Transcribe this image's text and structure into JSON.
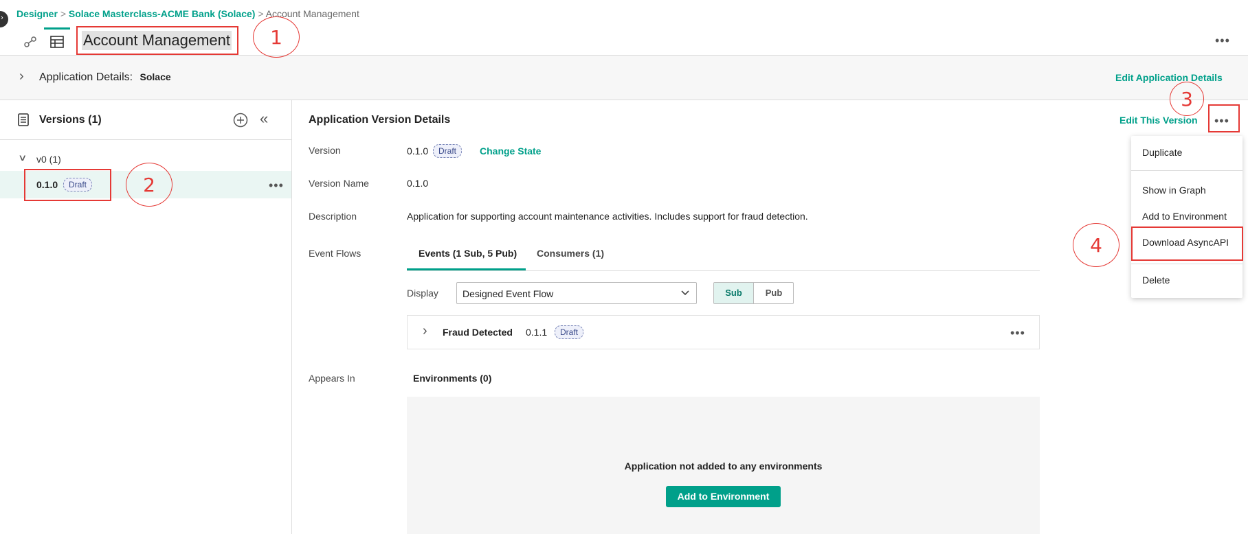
{
  "breadcrumb": {
    "items": [
      "Designer",
      "Solace Masterclass-ACME Bank (Solace)",
      "Account Management"
    ],
    "separator": ">"
  },
  "header": {
    "title": "Account Management"
  },
  "app_details": {
    "label": "Application Details:",
    "value": "Solace",
    "edit_link": "Edit Application Details"
  },
  "versions_panel": {
    "title": "Versions (1)",
    "group": "v0 (1)",
    "items": [
      {
        "version": "0.1.0",
        "state": "Draft"
      }
    ]
  },
  "version_details": {
    "title": "Application Version Details",
    "edit_link": "Edit This Version",
    "version_label": "Version",
    "version_value": "0.1.0",
    "version_state": "Draft",
    "change_state": "Change State",
    "name_label": "Version Name",
    "name_value": "0.1.0",
    "description_label": "Description",
    "description_value": "Application for supporting account maintenance activities. Includes support for fraud detection.",
    "event_flows_label": "Event Flows",
    "tabs": [
      "Events (1 Sub, 5 Pub)",
      "Consumers (1)"
    ],
    "display_label": "Display",
    "display_value": "Designed Event Flow",
    "toggle": [
      "Sub",
      "Pub"
    ],
    "event": {
      "name": "Fraud Detected",
      "version": "0.1.1",
      "state": "Draft"
    },
    "appears_in_label": "Appears In",
    "environments_title": "Environments (0)",
    "empty_message": "Application not added to any environments",
    "add_env_button": "Add to Environment"
  },
  "context_menu": {
    "items": [
      "Duplicate",
      "Show in Graph",
      "Add to Environment",
      "Download AsyncAPI",
      "Delete"
    ]
  },
  "annotations": [
    "1",
    "2",
    "3",
    "4"
  ],
  "colors": {
    "accent": "#00a08a",
    "annotation": "#e53935",
    "badge_border": "#7a86b8"
  }
}
